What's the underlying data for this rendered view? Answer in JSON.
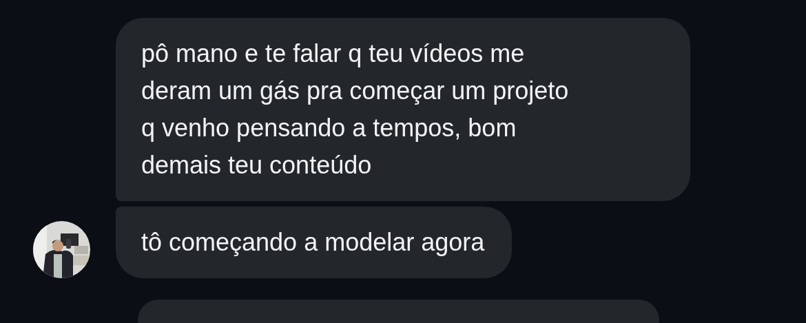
{
  "messages": [
    {
      "kind": "text",
      "text": "pô mano e te falar q teu vídeos me deram um gás pra começar um projeto q venho pensando a tempos, bom demais teu conteúdo",
      "avatar": false
    },
    {
      "kind": "text",
      "text": "tô começando a modelar agora",
      "avatar": true
    },
    {
      "kind": "cut",
      "avatar": false
    }
  ]
}
